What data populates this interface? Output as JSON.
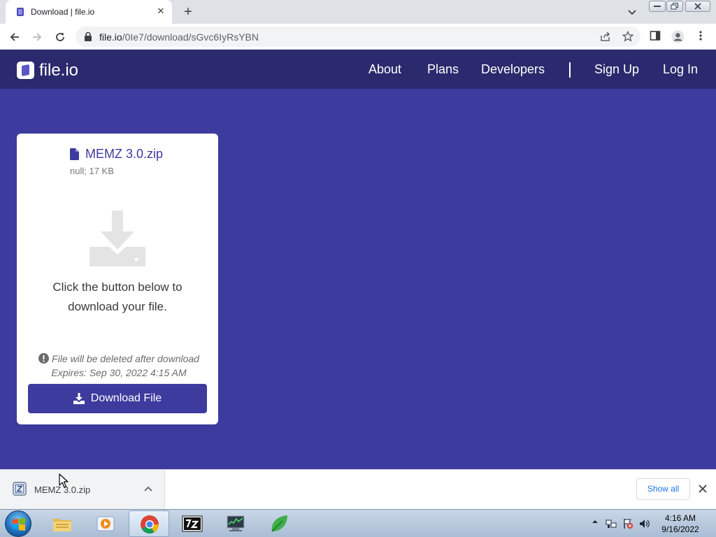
{
  "browser": {
    "tab_title": "Download | file.io",
    "url_host": "file.io",
    "url_path": "/0Ie7/download/sGvc6IyRsYBN"
  },
  "site": {
    "logo_text": "file.io",
    "nav": {
      "about": "About",
      "plans": "Plans",
      "developers": "Developers",
      "signup": "Sign Up",
      "login": "Log In"
    }
  },
  "file": {
    "name": "MEMZ 3.0.zip",
    "meta": "null; 17 KB",
    "instructions": "Click the button below to download your file.",
    "notice_delete": "File will be deleted after download",
    "notice_expires": "Expires: Sep 30, 2022 4:15 AM",
    "download_button": "Download File"
  },
  "download_shelf": {
    "file_name": "MEMZ 3.0.zip",
    "show_all": "Show all"
  },
  "taskbar": {
    "time": "4:16 AM",
    "date": "9/16/2022",
    "apps": [
      "explorer-icon",
      "media-player-icon",
      "chrome-icon",
      "7zip-icon",
      "task-manager-icon",
      "leaf-icon"
    ]
  },
  "colors": {
    "page_background": "#3d3b9e",
    "site_header": "#2b2a6e",
    "accent": "#3d3b9e"
  }
}
